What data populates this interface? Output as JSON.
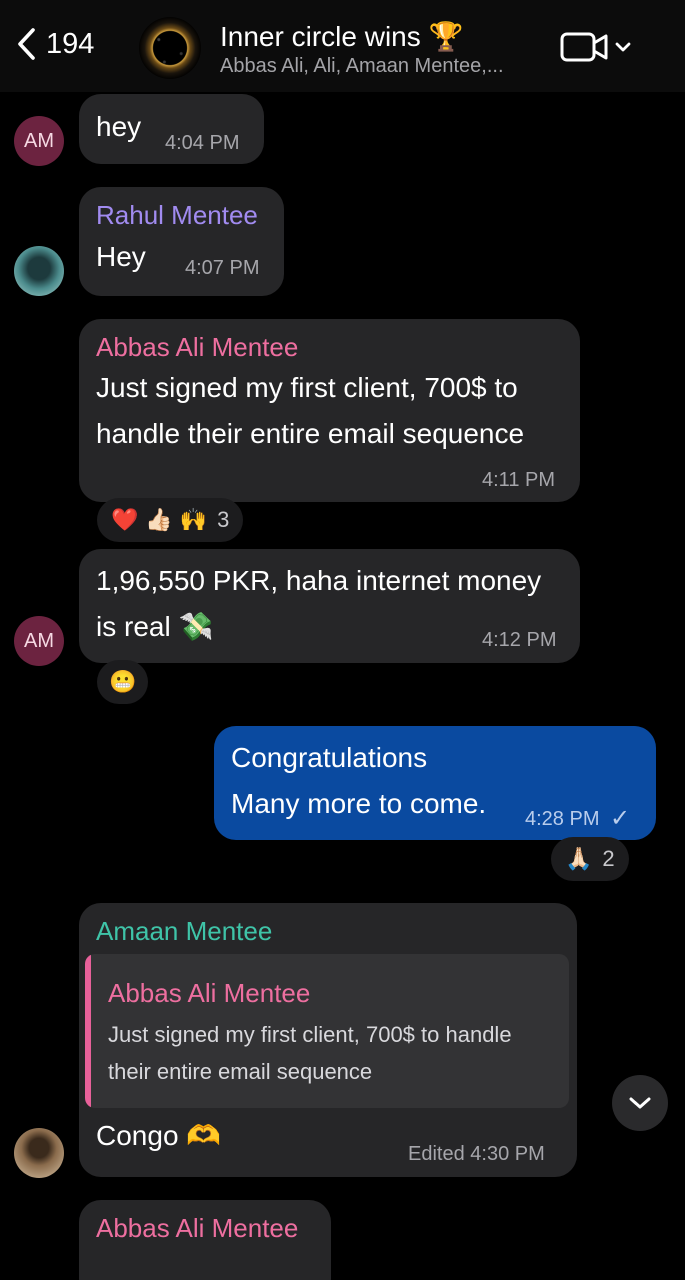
{
  "header": {
    "back_count": "194",
    "title": "Inner circle wins 🏆",
    "subtitle": "Abbas Ali, Ali, Amaan Mentee,..."
  },
  "messages": [
    {
      "id": "m1",
      "sender_initials": "AM",
      "text": "hey",
      "time": "4:04 PM"
    },
    {
      "id": "m2",
      "sender": "Rahul Mentee",
      "sender_color": "#a18bf0",
      "text": "Hey",
      "time": "4:07 PM"
    },
    {
      "id": "m3",
      "sender": "Abbas Ali Mentee",
      "sender_color": "#ee6fa0",
      "lines": [
        "Just signed my first client, 700$ to",
        "handle their entire email sequence"
      ],
      "time": "4:11 PM",
      "reactions": {
        "emojis": "❤️ 👍🏻 🙌",
        "count": "3"
      }
    },
    {
      "id": "m4",
      "sender_initials": "AM",
      "lines": [
        "1,96,550 PKR, haha internet money",
        "is real 💸"
      ],
      "time": "4:12 PM",
      "reactions": {
        "emojis": "😬"
      }
    },
    {
      "id": "m5",
      "outgoing": true,
      "lines": [
        "Congratulations",
        "Many more to come."
      ],
      "time": "4:28 PM",
      "status": "✓",
      "reactions": {
        "emojis": "🙏🏻",
        "count": "2"
      }
    },
    {
      "id": "m6",
      "sender": "Amaan Mentee",
      "sender_color": "#3fc4a8",
      "quote": {
        "name": "Abbas Ali Mentee",
        "lines": [
          "Just signed my first client, 700$ to handle",
          "their entire email sequence"
        ]
      },
      "text": "Congo 🫶",
      "time": "Edited 4:30 PM"
    },
    {
      "id": "m7",
      "sender": "Abbas Ali Mentee",
      "sender_color": "#ee6fa0"
    }
  ],
  "icons": {
    "back": "chevron-left-icon",
    "video": "video-camera-icon",
    "scroll_down": "chevron-down-icon"
  }
}
